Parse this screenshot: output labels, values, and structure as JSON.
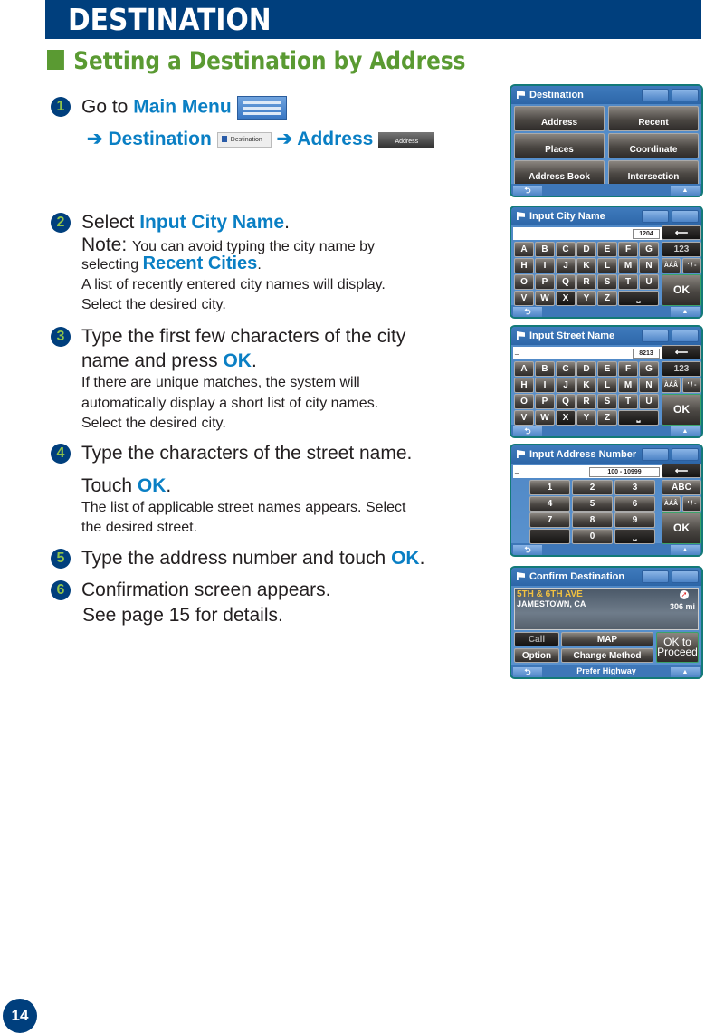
{
  "header": {
    "title": "DESTINATION"
  },
  "section": {
    "title": "Setting a Destination by Address"
  },
  "steps": [
    {
      "num": "1",
      "line1_pre": "Go to ",
      "line1_b": "Main Menu",
      "line2_arrow1": "➔ ",
      "line2_b1": "Destination",
      "line2_arrow2": " ➔ ",
      "line2_b2": "Address",
      "dest_icon_label": "Destination",
      "addr_icon_label": "Address"
    },
    {
      "num": "2",
      "line1_pre": "Select ",
      "line1_b": "Input City Name",
      "line1_post": ".",
      "note_label": "Note: ",
      "note_text": "You can avoid typing the city name by",
      "note2_pre": "selecting ",
      "note2_b": "Recent Cities",
      "note2_post": ".",
      "s1": "A list of recently entered city names will display.",
      "s2": "Select the desired city."
    },
    {
      "num": "3",
      "line1": "Type the first few characters of the city",
      "line2_pre": "name and press ",
      "line2_b": "OK",
      "line2_post": ".",
      "s1": "If there are unique matches, the system will",
      "s2": "automatically display a short list of city names.",
      "s3": "Select the desired city."
    },
    {
      "num": "4",
      "line1": "Type the characters of the street name.",
      "line2_pre": "Touch ",
      "line2_b": "OK",
      "line2_post": ".",
      "s1": "The list of applicable street names appears. Select",
      "s2": "the desired street."
    },
    {
      "num": "5",
      "line1_pre": "Type the address number and touch ",
      "line1_b": "OK",
      "line1_post": "."
    },
    {
      "num": "6",
      "line1": "Confirmation screen appears.",
      "line2": "See page 15 for details."
    }
  ],
  "screens": {
    "destination": {
      "title": "Destination",
      "buttons": [
        "Address",
        "Recent",
        "Places",
        "Coordinate",
        "Address Book",
        "Intersection"
      ]
    },
    "city": {
      "title": "Input City Name",
      "count": "1204",
      "cursor": "_"
    },
    "street": {
      "title": "Input Street Name",
      "count": "8213",
      "cursor": "_"
    },
    "keyboard": {
      "letters": [
        "A",
        "B",
        "C",
        "D",
        "E",
        "F",
        "G",
        "H",
        "I",
        "J",
        "K",
        "L",
        "M",
        "N",
        "O",
        "P",
        "Q",
        "R",
        "S",
        "T",
        "U",
        "V",
        "W",
        "X",
        "Y",
        "Z"
      ],
      "mode": "123",
      "accent": "ÀÁÂ",
      "sym": "' / -",
      "ok": "OK",
      "backspace": "⟵",
      "space": "⎵"
    },
    "number": {
      "title": "Input Address Number",
      "range": "100 - 10999",
      "cursor": "_",
      "digits": [
        "1",
        "2",
        "3",
        "4",
        "5",
        "6",
        "7",
        "8",
        "9",
        "0"
      ],
      "mode": "ABC"
    },
    "confirm": {
      "title": "Confirm Destination",
      "street": "5TH & 6TH AVE",
      "city": "JAMESTOWN, CA",
      "distance": "306 mi",
      "call": "Call",
      "map": "MAP",
      "option": "Option",
      "change": "Change Method",
      "ok1": "OK  to",
      "ok2": "Proceed",
      "route": "Prefer Highway"
    }
  },
  "page_number": "14",
  "colors": {
    "header_blue": "#003f7d",
    "section_green": "#5a9a32",
    "keyword_blue": "#0a7fc4"
  }
}
